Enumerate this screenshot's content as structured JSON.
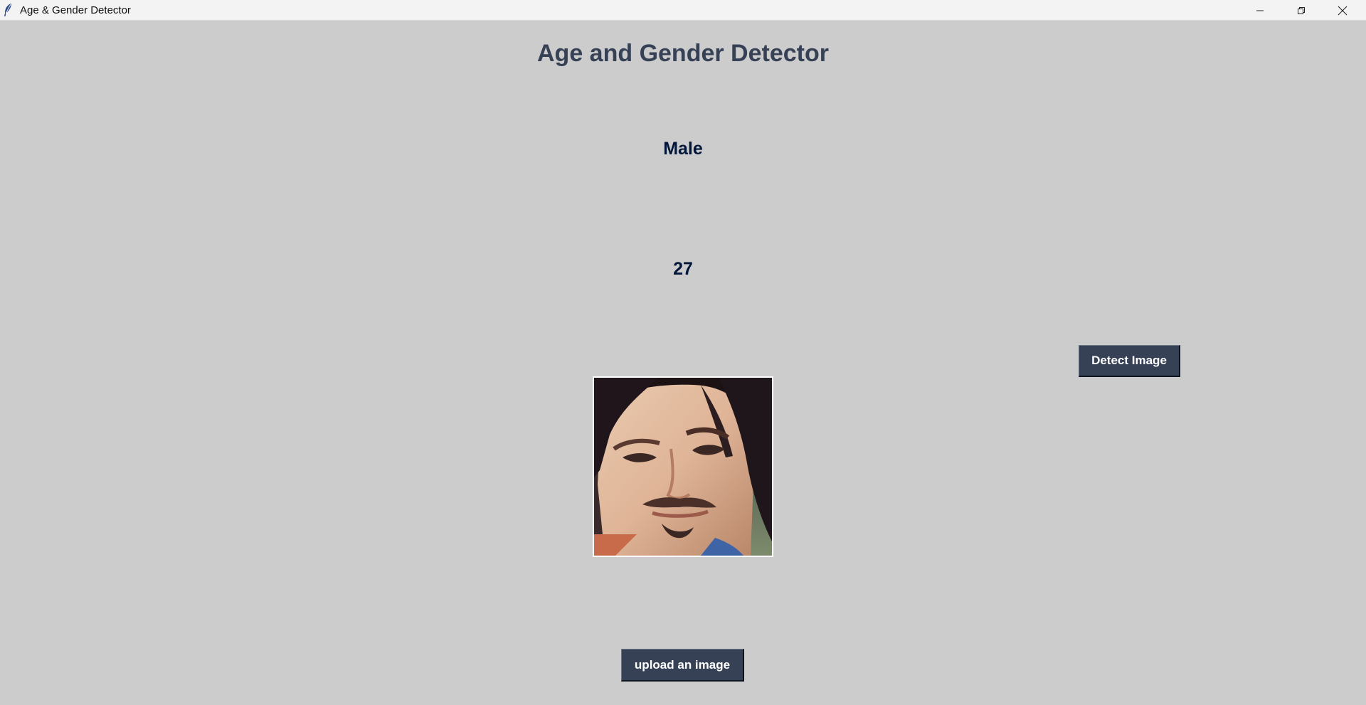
{
  "window": {
    "title": "Age & Gender Detector",
    "controls": [
      "minimize-icon",
      "restore-icon",
      "close-icon"
    ]
  },
  "main": {
    "heading": "Age and Gender Detector",
    "gender_result": "Male",
    "age_result": "27",
    "detect_button_label": "Detect Image",
    "upload_button_label": "upload an image"
  },
  "colors": {
    "background": "#cccccc",
    "heading": "#364156",
    "result_text": "#011638",
    "button_bg": "#364156",
    "button_text": "#ffffff"
  }
}
